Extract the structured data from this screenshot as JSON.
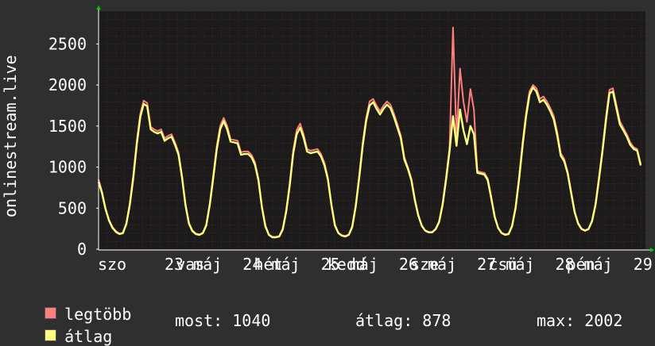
{
  "chart_data": {
    "type": "line",
    "ylabel": "onlinestream.live",
    "ylim": [
      0,
      2900
    ],
    "yticks": [
      0,
      500,
      1000,
      1500,
      2000,
      2500
    ],
    "x_ticks": [
      "szo",
      "23 máj",
      "vas",
      "24 máj",
      "hét",
      "25 máj",
      "kedd",
      "26 máj",
      "sze",
      "27 máj",
      "csü",
      "28 máj",
      "pén",
      "29 máj"
    ],
    "grid": true,
    "colors": {
      "background": "#2f2f2f",
      "plot_bg": "#1b1b1b",
      "grid": "#4a2020",
      "axis": "#ffffff",
      "max_series": "#ff7f7f",
      "avg_series": "#ffff7f",
      "arrow": "#00cc00"
    },
    "series": [
      {
        "name": "legtöbb",
        "color": "#ff7f7f",
        "values": [
          850,
          700,
          500,
          360,
          270,
          220,
          190,
          200,
          320,
          560,
          900,
          1320,
          1650,
          1810,
          1780,
          1490,
          1460,
          1440,
          1460,
          1350,
          1380,
          1400,
          1300,
          1180,
          900,
          550,
          320,
          230,
          190,
          180,
          200,
          300,
          560,
          900,
          1250,
          1500,
          1600,
          1500,
          1340,
          1330,
          1320,
          1180,
          1190,
          1190,
          1150,
          1060,
          860,
          520,
          290,
          180,
          150,
          150,
          160,
          250,
          480,
          800,
          1200,
          1450,
          1530,
          1400,
          1220,
          1200,
          1210,
          1220,
          1160,
          1050,
          870,
          550,
          300,
          200,
          170,
          160,
          180,
          280,
          540,
          900,
          1300,
          1600,
          1800,
          1830,
          1750,
          1680,
          1750,
          1800,
          1760,
          1650,
          1520,
          1380,
          1120,
          1000,
          860,
          620,
          420,
          290,
          230,
          210,
          210,
          250,
          340,
          560,
          880,
          1240,
          2700,
          1350,
          2200,
          1800,
          1550,
          1950,
          1700,
          950,
          940,
          930,
          860,
          640,
          400,
          260,
          200,
          180,
          190,
          290,
          520,
          880,
          1300,
          1650,
          1920,
          2000,
          1960,
          1830,
          1860,
          1800,
          1720,
          1620,
          1420,
          1170,
          1100,
          940,
          700,
          460,
          320,
          250,
          230,
          250,
          350,
          560,
          880,
          1220,
          1610,
          1940,
          1960,
          1760,
          1560,
          1480,
          1400,
          1300,
          1240,
          1220,
          1040
        ]
      },
      {
        "name": "átlag",
        "color": "#ffff7f",
        "values": [
          820,
          680,
          490,
          350,
          260,
          210,
          185,
          195,
          310,
          540,
          870,
          1280,
          1610,
          1770,
          1740,
          1460,
          1430,
          1410,
          1430,
          1320,
          1350,
          1370,
          1270,
          1150,
          880,
          540,
          310,
          220,
          185,
          175,
          195,
          290,
          540,
          870,
          1210,
          1460,
          1560,
          1460,
          1310,
          1300,
          1290,
          1150,
          1160,
          1160,
          1120,
          1030,
          840,
          510,
          280,
          175,
          145,
          145,
          155,
          240,
          460,
          770,
          1160,
          1400,
          1480,
          1360,
          1190,
          1170,
          1180,
          1190,
          1130,
          1020,
          850,
          540,
          290,
          195,
          165,
          155,
          175,
          270,
          520,
          870,
          1260,
          1560,
          1750,
          1790,
          1710,
          1640,
          1710,
          1760,
          1720,
          1610,
          1480,
          1350,
          1090,
          980,
          840,
          600,
          410,
          285,
          225,
          205,
          205,
          245,
          330,
          540,
          850,
          1200,
          1620,
          1260,
          1700,
          1450,
          1280,
          1500,
          1400,
          930,
          920,
          910,
          840,
          620,
          390,
          255,
          195,
          175,
          185,
          280,
          500,
          850,
          1260,
          1610,
          1880,
          1970,
          1920,
          1790,
          1820,
          1760,
          1680,
          1580,
          1380,
          1140,
          1070,
          920,
          680,
          450,
          310,
          245,
          225,
          245,
          340,
          540,
          850,
          1190,
          1570,
          1900,
          1920,
          1720,
          1520,
          1450,
          1370,
          1270,
          1220,
          1200,
          1020
        ]
      }
    ]
  },
  "legend": {
    "max_label": "legtöbb",
    "avg_label": "átlag"
  },
  "stats": {
    "now": "most: 1040",
    "avg": "átlag: 878",
    "max": "max: 2002"
  }
}
